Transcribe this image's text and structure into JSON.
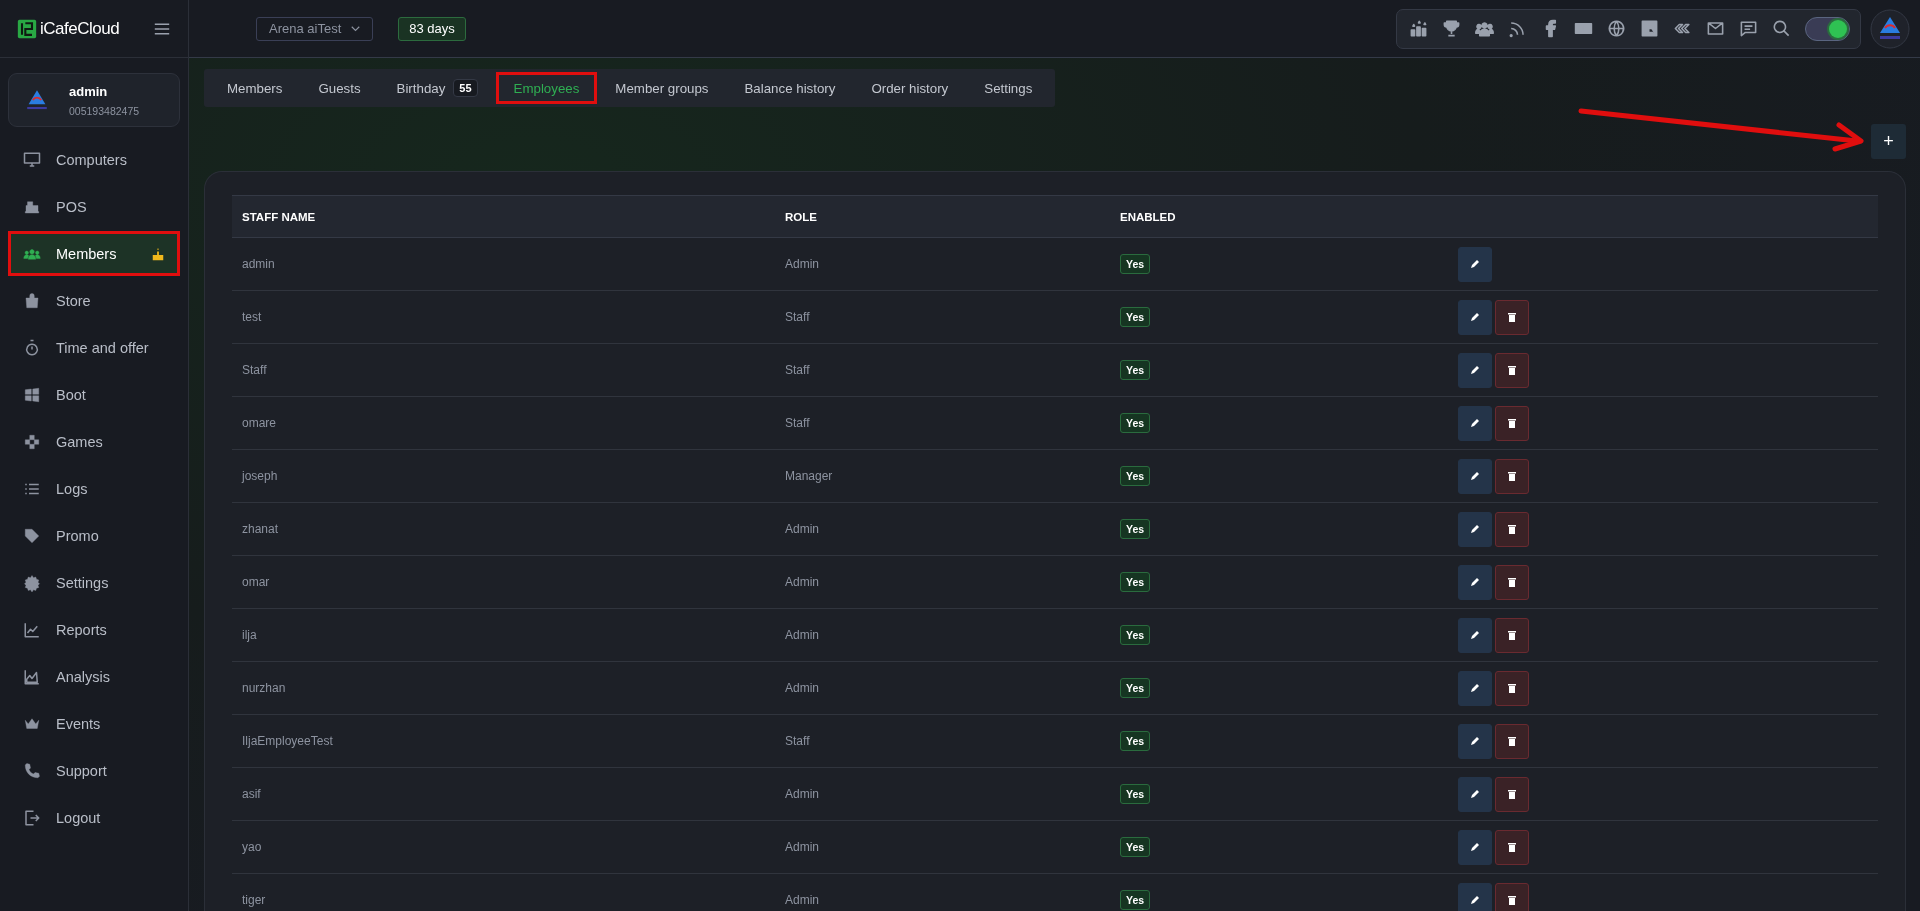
{
  "brand": {
    "name": "iCafeCloud"
  },
  "topbar": {
    "cafe_select": "Arena aiTest",
    "license": "83 days",
    "dark_mode": {
      "on": true
    }
  },
  "user": {
    "name": "admin",
    "id": "005193482475"
  },
  "sidebar": {
    "items": [
      {
        "label": "Computers",
        "selected": false,
        "highlighted": false
      },
      {
        "label": "POS",
        "selected": false,
        "highlighted": false
      },
      {
        "label": "Members",
        "selected": true,
        "highlighted": true,
        "birthday_alert": true
      },
      {
        "label": "Store",
        "selected": false,
        "highlighted": false
      },
      {
        "label": "Time and offer",
        "selected": false,
        "highlighted": false
      },
      {
        "label": "Boot",
        "selected": false,
        "highlighted": false
      },
      {
        "label": "Games",
        "selected": false,
        "highlighted": false
      },
      {
        "label": "Logs",
        "selected": false,
        "highlighted": false
      },
      {
        "label": "Promo",
        "selected": false,
        "highlighted": false
      },
      {
        "label": "Settings",
        "selected": false,
        "highlighted": false
      },
      {
        "label": "Reports",
        "selected": false,
        "highlighted": false
      },
      {
        "label": "Analysis",
        "selected": false,
        "highlighted": false
      },
      {
        "label": "Events",
        "selected": false,
        "highlighted": false
      },
      {
        "label": "Support",
        "selected": false,
        "highlighted": false
      },
      {
        "label": "Logout",
        "selected": false,
        "highlighted": false
      }
    ]
  },
  "tabs": [
    {
      "label": "Members",
      "selected": false,
      "highlighted": false
    },
    {
      "label": "Guests",
      "selected": false,
      "highlighted": false
    },
    {
      "label": "Birthday",
      "badge": "55",
      "selected": false,
      "highlighted": false
    },
    {
      "label": "Employees",
      "selected": true,
      "highlighted": true
    },
    {
      "label": "Member groups",
      "selected": false,
      "highlighted": false
    },
    {
      "label": "Balance history",
      "selected": false,
      "highlighted": false
    },
    {
      "label": "Order history",
      "selected": false,
      "highlighted": false
    },
    {
      "label": "Settings",
      "selected": false,
      "highlighted": false
    }
  ],
  "add_button": {
    "label": "+",
    "pointed_by_arrow": true
  },
  "table": {
    "columns": [
      "STAFF NAME",
      "ROLE",
      "ENABLED"
    ],
    "rows": [
      {
        "name": "admin",
        "role": "Admin",
        "enabled": "Yes",
        "deletable": false
      },
      {
        "name": "test",
        "role": "Staff",
        "enabled": "Yes",
        "deletable": true
      },
      {
        "name": "Staff",
        "role": "Staff",
        "enabled": "Yes",
        "deletable": true
      },
      {
        "name": "omare",
        "role": "Staff",
        "enabled": "Yes",
        "deletable": true
      },
      {
        "name": "joseph",
        "role": "Manager",
        "enabled": "Yes",
        "deletable": true
      },
      {
        "name": "zhanat",
        "role": "Admin",
        "enabled": "Yes",
        "deletable": true
      },
      {
        "name": "omar",
        "role": "Admin",
        "enabled": "Yes",
        "deletable": true
      },
      {
        "name": "ilja",
        "role": "Admin",
        "enabled": "Yes",
        "deletable": true
      },
      {
        "name": "nurzhan",
        "role": "Admin",
        "enabled": "Yes",
        "deletable": true
      },
      {
        "name": "IljaEmployeeTest",
        "role": "Staff",
        "enabled": "Yes",
        "deletable": true
      },
      {
        "name": "asif",
        "role": "Admin",
        "enabled": "Yes",
        "deletable": true
      },
      {
        "name": "yao",
        "role": "Admin",
        "enabled": "Yes",
        "deletable": true
      },
      {
        "name": "tiger",
        "role": "Admin",
        "enabled": "Yes",
        "deletable": true
      }
    ]
  }
}
